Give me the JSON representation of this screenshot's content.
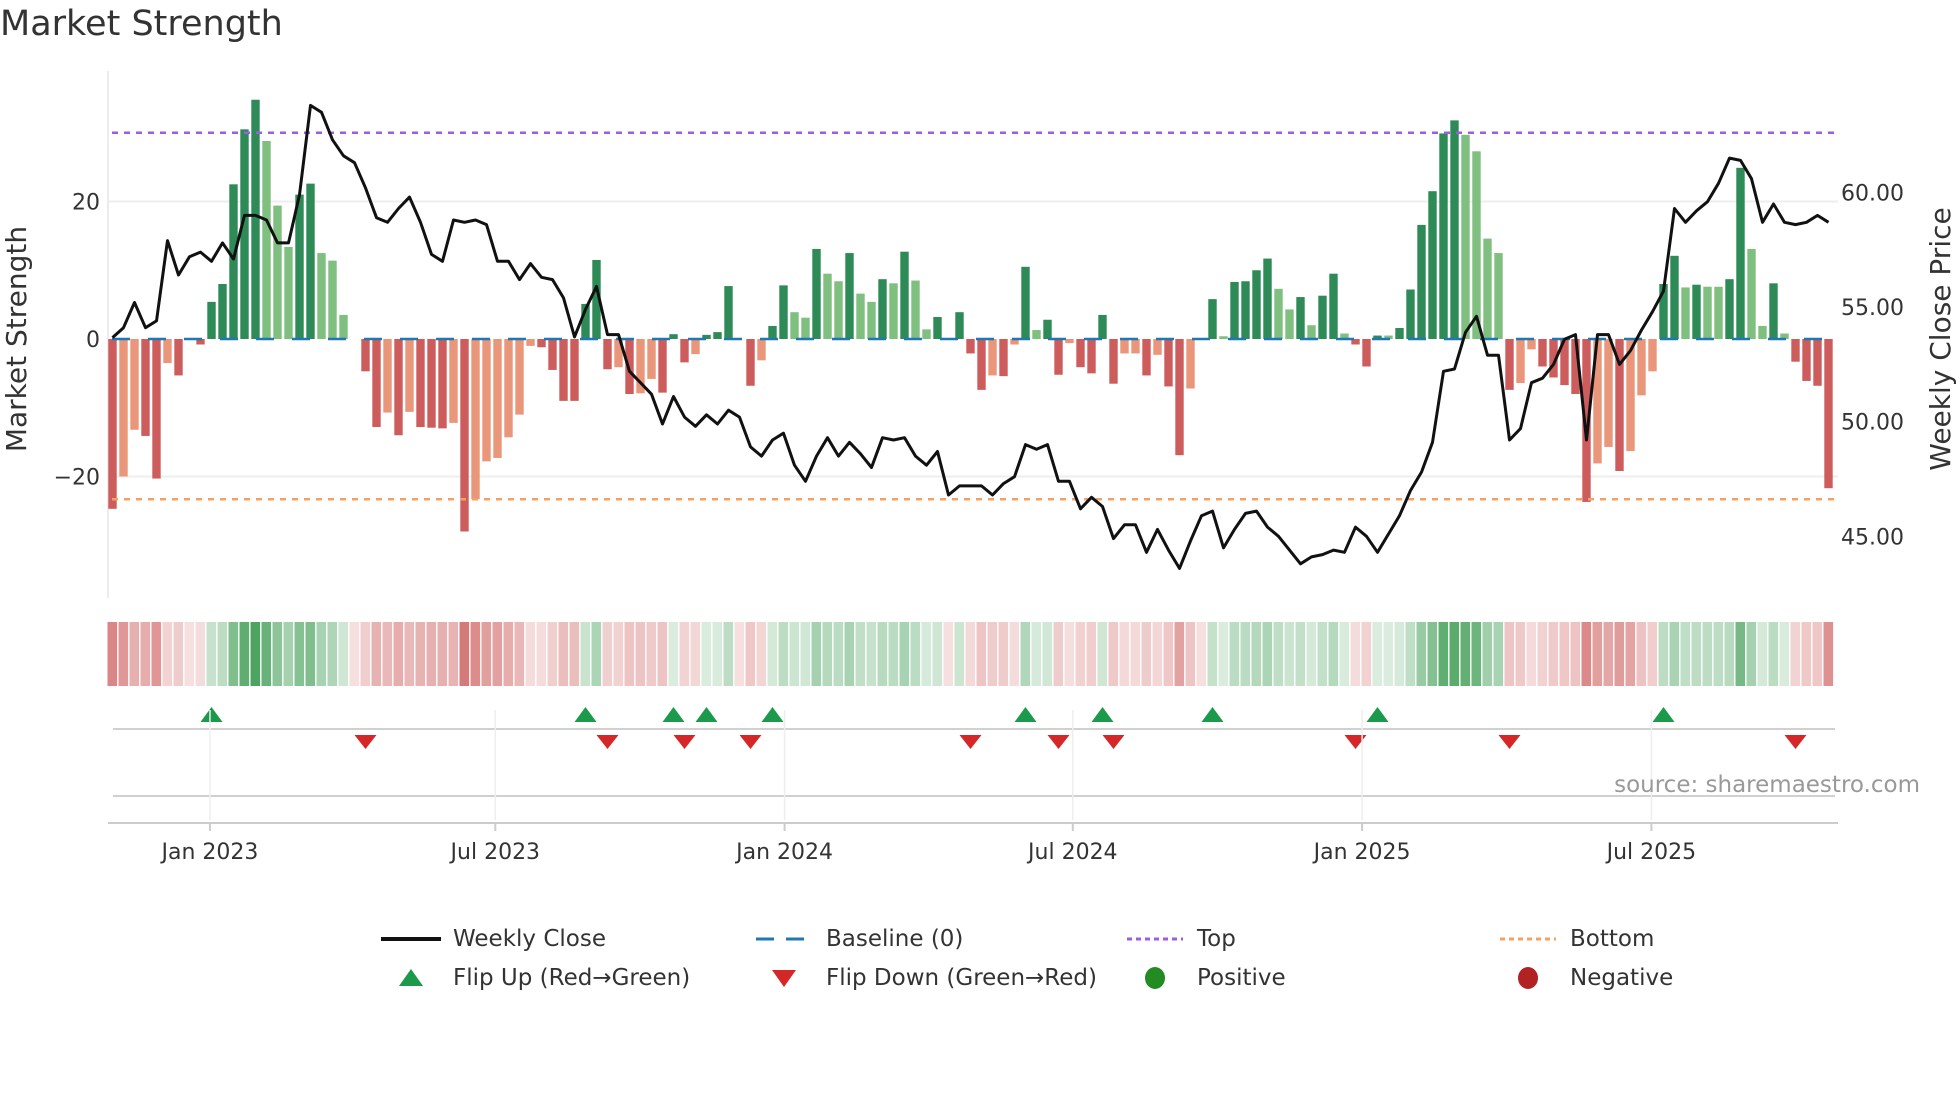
{
  "title": "Market Strength",
  "source": "source: sharemaestro.com",
  "colors": {
    "pos_strong": "#2e8b57",
    "pos_weak": "#7fbf7f",
    "neg_strong": "#cd5c5c",
    "neg_weak": "#e9967a",
    "strip_pos": "#3a9a4f",
    "strip_neg": "#c9504f",
    "price": "#111111",
    "baseline": "#1f77b4",
    "top": "#9b5de5",
    "bottom": "#f4a261",
    "flip_up": "#1a9a4a",
    "flip_down": "#d62728",
    "positive": "#228b22",
    "negative": "#b22222"
  },
  "chart_data": {
    "type": "bar+line",
    "title": "Market Strength",
    "ylabel": "Market Strength",
    "y2label": "Weekly Close Price",
    "ylim": [
      -37.5,
      37.5
    ],
    "y2lim": [
      42.3,
      64.9
    ],
    "yticks": [
      {
        "v": 20,
        "label": "20"
      },
      {
        "v": 0,
        "label": "0"
      },
      {
        "v": -20,
        "label": "−20"
      }
    ],
    "y2ticks": [
      {
        "v": 60,
        "label": "60.00"
      },
      {
        "v": 55,
        "label": "55.00"
      },
      {
        "v": 50,
        "label": "50.00"
      },
      {
        "v": 45,
        "label": "45.00"
      }
    ],
    "xticks": [
      {
        "week": 8.86,
        "label": "Jan 2023"
      },
      {
        "week": 34.8,
        "label": "Jul 2023"
      },
      {
        "week": 61.1,
        "label": "Jan 2024"
      },
      {
        "week": 87.3,
        "label": "Jul 2024"
      },
      {
        "week": 113.6,
        "label": "Jan 2025"
      },
      {
        "week": 139.9,
        "label": "Jul 2025"
      }
    ],
    "top_level": 30,
    "bottom_level": -23.3,
    "baseline": 0,
    "strength": [
      -24.7,
      -20,
      -13.2,
      -14.1,
      -20.3,
      -3.5,
      -5.3,
      0,
      -0.8,
      5.4,
      8,
      22.5,
      30.5,
      34.8,
      28.8,
      19.4,
      13.4,
      21,
      22.6,
      12.5,
      11.4,
      3.5,
      0,
      -4.7,
      -12.8,
      -10.7,
      -14,
      -10.6,
      -12.8,
      -12.9,
      -13,
      -12.2,
      -28,
      -23.3,
      -17.8,
      -17.3,
      -14.3,
      -11,
      -1,
      -1.2,
      -4.5,
      -9,
      -9,
      5.1,
      11.5,
      -4.4,
      -4.1,
      -8,
      -7.9,
      -5.8,
      -7.8,
      0.7,
      -3.4,
      -2.2,
      0.6,
      1,
      7.7,
      0,
      -6.8,
      -3.1,
      1.9,
      7.8,
      3.9,
      3.1,
      13.1,
      9.5,
      8.4,
      12.5,
      6.6,
      5.4,
      8.7,
      8.1,
      12.7,
      8.5,
      1.4,
      3.2,
      0,
      3.9,
      -2.1,
      -7.4,
      -5.3,
      -5.4,
      -0.8,
      10.5,
      1.3,
      2.8,
      -5.2,
      -0.6,
      -4.1,
      -5,
      3.5,
      -6.5,
      -2.1,
      -2.1,
      -5.3,
      -2.3,
      -6.9,
      -16.9,
      -7.2,
      0,
      5.8,
      0.4,
      8.3,
      8.4,
      10,
      11.7,
      7.3,
      4.3,
      6.1,
      2,
      6.3,
      9.5,
      0.8,
      -0.8,
      -4,
      0.5,
      0.5,
      1.6,
      7.2,
      16.6,
      21.5,
      29.9,
      31.8,
      29.7,
      27.3,
      14.6,
      12.5,
      -7.4,
      -6.4,
      -1.5,
      -4,
      -5.6,
      -6.7,
      -8,
      -23.7,
      -18.1,
      -15.7,
      -19.2,
      -16.3,
      -8.2,
      -4.7,
      8,
      12.1,
      7.5,
      7.9,
      7.6,
      7.6,
      8.7,
      24.9,
      13.1,
      1.9,
      8.1,
      0.8,
      -3.3,
      -6.1,
      -6.8,
      -21.7
    ],
    "bar_shade": "dllddld-ddddddlllddlll-ddldldddldlllllldddddddldlldddlddd-dlddlldlldlldldlld-dddldldlddlddddlldlddl-dlddddlldlddldddlddddddlllldlldddddlldlllddldllddlldldddd",
    "weekly_close": [
      53.67,
      54.1,
      55.2,
      54.1,
      54.4,
      57.9,
      56.4,
      57.2,
      57.4,
      57.0,
      57.8,
      57.1,
      59.0,
      59.0,
      58.8,
      57.8,
      57.8,
      59.9,
      63.8,
      63.5,
      62.3,
      61.6,
      61.3,
      60.2,
      58.9,
      58.7,
      59.3,
      59.8,
      58.7,
      57.3,
      57.0,
      58.8,
      58.7,
      58.8,
      58.6,
      57.0,
      57.0,
      56.2,
      56.9,
      56.3,
      56.2,
      55.4,
      53.7,
      54.9,
      55.9,
      53.8,
      53.8,
      52.2,
      51.7,
      51.2,
      49.9,
      51.1,
      50.2,
      49.8,
      50.3,
      49.9,
      50.5,
      50.2,
      48.9,
      48.5,
      49.2,
      49.5,
      48.1,
      47.4,
      48.5,
      49.3,
      48.5,
      49.1,
      48.6,
      48.0,
      49.3,
      49.2,
      49.3,
      48.5,
      48.1,
      48.7,
      46.8,
      47.2,
      47.2,
      47.2,
      46.8,
      47.3,
      47.6,
      49.0,
      48.8,
      49.0,
      47.4,
      47.4,
      46.2,
      46.7,
      46.3,
      44.9,
      45.5,
      45.5,
      44.3,
      45.3,
      44.4,
      43.6,
      44.8,
      45.9,
      46.1,
      44.5,
      45.3,
      46.0,
      46.1,
      45.4,
      45.0,
      44.4,
      43.8,
      44.1,
      44.2,
      44.4,
      44.3,
      45.4,
      45.0,
      44.3,
      45.1,
      45.9,
      47.0,
      47.8,
      49.1,
      52.2,
      52.3,
      53.9,
      54.6,
      52.9,
      52.9,
      49.2,
      49.7,
      51.7,
      51.9,
      52.5,
      53.6,
      53.8,
      49.2,
      53.8,
      53.8,
      52.5,
      53.1,
      54.0,
      54.8,
      55.7,
      59.3,
      58.7,
      59.2,
      59.6,
      60.4,
      61.5,
      61.4,
      60.6,
      58.7,
      59.5,
      58.7,
      58.6,
      58.7,
      59.0,
      58.7
    ],
    "flip_up_weeks": [
      10,
      44,
      52,
      55,
      61,
      84,
      91,
      101,
      116,
      142
    ],
    "flip_down_weeks": [
      24,
      46,
      53,
      59,
      79,
      87,
      92,
      114,
      128,
      154
    ],
    "legend_placement": "bottom-center"
  },
  "legend": {
    "weekly_close": "Weekly Close",
    "baseline": "Baseline (0)",
    "top": "Top",
    "bottom": "Bottom",
    "flip_up": "Flip Up (Red→Green)",
    "flip_down": "Flip Down (Green→Red)",
    "positive": "Positive",
    "negative": "Negative"
  }
}
